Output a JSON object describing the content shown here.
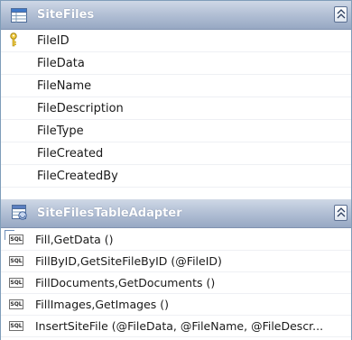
{
  "table": {
    "name": "SiteFiles",
    "columns": [
      "FileID",
      "FileData",
      "FileName",
      "FileDescription",
      "FileType",
      "FileCreated",
      "FileCreatedBy"
    ],
    "primary_key_icon": "key-icon",
    "table_icon": "table-icon",
    "collapse_icon": "collapse-chevron-icon"
  },
  "adapter": {
    "name": "SiteFilesTableAdapter",
    "adapter_icon": "table-adapter-icon",
    "collapse_icon": "collapse-chevron-icon",
    "query_icon": "sql-query-icon",
    "queries": [
      "Fill,GetData ()",
      "FillByID,GetSiteFileByID (@FileID)",
      "FillDocuments,GetDocuments ()",
      "FillImages,GetImages ()",
      "InsertSiteFile (@FileData, @FileName, @FileDescr..."
    ],
    "sql_badge": "SQL"
  },
  "colors": {
    "header_gradient_top": "#cfd8e6",
    "header_gradient_bottom": "#97a8c3",
    "header_text": "#ffffff",
    "border": "#7f9db9",
    "key_gold": "#d9b21f"
  }
}
